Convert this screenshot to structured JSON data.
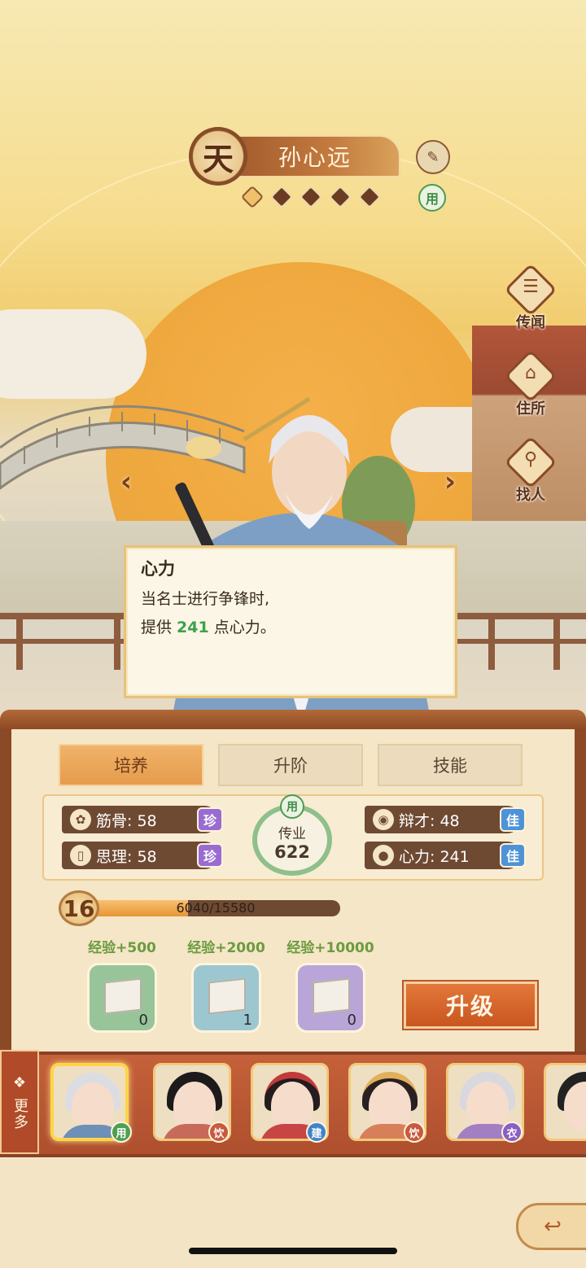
{
  "header": {
    "rank_char": "天",
    "name": "孙心远",
    "use_tag": "用"
  },
  "side_nav": [
    {
      "label": "传闻",
      "icon": "scroll-icon"
    },
    {
      "label": "住所",
      "icon": "house-icon"
    },
    {
      "label": "找人",
      "icon": "magnifier-person-icon"
    }
  ],
  "tooltip": {
    "title": "心力",
    "line1": "当名士进行争锋时,",
    "line2_prefix": "提供 ",
    "line2_value": "241",
    "line2_suffix": " 点心力。"
  },
  "tabs": [
    "培养",
    "升阶",
    "技能"
  ],
  "stats": {
    "jingu": {
      "label": "筋骨: 58",
      "grade": "珍"
    },
    "sili": {
      "label": "思理: 58",
      "grade": "珍"
    },
    "biancai": {
      "label": "辩才: 48",
      "grade": "佳"
    },
    "xinli": {
      "label": "心力: 241",
      "grade": "佳"
    }
  },
  "chuanye": {
    "label": "传业",
    "value": "622",
    "tag": "用"
  },
  "level": {
    "value": "16",
    "exp_text": "6040/15580",
    "progress": 0.3879
  },
  "books": [
    {
      "label": "经验+500",
      "count": "0"
    },
    {
      "label": "经验+2000",
      "count": "1"
    },
    {
      "label": "经验+10000",
      "count": "0"
    }
  ],
  "upgrade_label": "升级",
  "more_label": "更多",
  "roster": [
    {
      "tag": "用",
      "tag_color": "#4e9e55"
    },
    {
      "tag": "饮",
      "tag_color": "#c85a3e"
    },
    {
      "tag": "建",
      "tag_color": "#3f84c6"
    },
    {
      "tag": "饮",
      "tag_color": "#c85a3e"
    },
    {
      "tag": "衣",
      "tag_color": "#8a5fc1"
    }
  ]
}
